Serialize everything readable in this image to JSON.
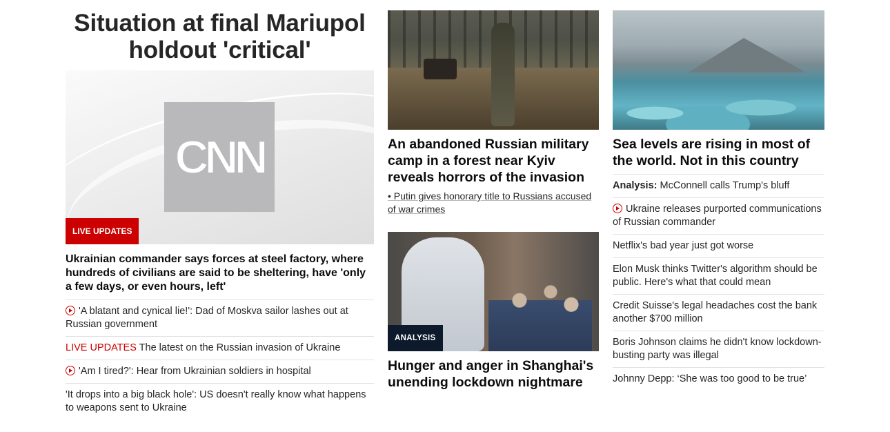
{
  "left": {
    "headline": "Situation at final Mariupol holdout 'critical'",
    "hero_logo_text": "CNN",
    "hero_badge": "LIVE UPDATES",
    "sub_headline": "Ukrainian commander says forces at steel factory, where hundreds of civilians are said to be sheltering, have 'only a few days, or even hours, left'",
    "links": [
      {
        "text": "'A blatant and cynical lie!': Dad of Moskva sailor lashes out at Russian government",
        "icon": "play-icon"
      },
      {
        "prefix": "LIVE UPDATES",
        "text": " The latest on the Russian invasion of Ukraine"
      },
      {
        "text": "'Am I tired?': Hear from Ukrainian soldiers in hospital",
        "icon": "play-icon"
      },
      {
        "text": "'It drops into a big black hole': US doesn't really know what happens to weapons sent to Ukraine"
      }
    ]
  },
  "middle": {
    "story1_headline": "An abandoned Russian military camp in a forest near Kyiv reveals horrors of the invasion",
    "story1_bullet": "• Putin gives honorary title to Russians accused of war crimes",
    "story2_badge": "ANALYSIS",
    "story2_headline": "Hunger and anger in Shanghai's unending lockdown nightmare"
  },
  "right": {
    "headline": "Sea levels are rising in most of the world. Not in this country",
    "links": [
      {
        "prefix": "Analysis:",
        "text": " McConnell calls Trump's bluff"
      },
      {
        "text": "Ukraine releases purported communications of Russian commander",
        "icon": "play-icon"
      },
      {
        "text": "Netflix's bad year just got worse"
      },
      {
        "text": "Elon Musk thinks Twitter's algorithm should be public. Here's what that could mean"
      },
      {
        "text": "Credit Suisse's legal headaches cost the bank another $700 million"
      },
      {
        "text": "Boris Johnson claims he didn't know lockdown-busting party was illegal"
      },
      {
        "text": "Johnny Depp: ‘She was too good to be true’"
      }
    ]
  },
  "colors": {
    "accent_red": "#cc0000",
    "analysis_navy": "#0c1a2b",
    "divider": "#e2e2e2"
  }
}
